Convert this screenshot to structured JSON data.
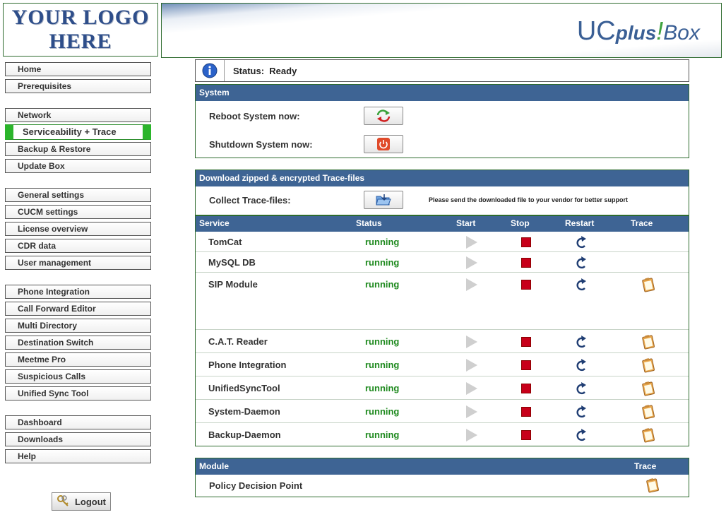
{
  "header": {
    "logo_line1": "YOUR LOGO",
    "logo_line2": "HERE",
    "brand_uc": "UC",
    "brand_plus": "plus",
    "brand_bang": "!",
    "brand_box": "Box"
  },
  "sidebar": {
    "groups": [
      [
        "Home",
        "Prerequisites"
      ],
      [
        "Network",
        "Serviceability + Trace",
        "Backup & Restore",
        "Update Box"
      ],
      [
        "General settings",
        "CUCM settings",
        "License overview",
        "CDR data",
        "User management"
      ],
      [
        "Phone Integration",
        "Call Forward Editor",
        "Multi Directory",
        "Destination Switch",
        "Meetme Pro",
        "Suspicious Calls",
        "Unified Sync Tool"
      ],
      [
        "Dashboard",
        "Downloads",
        "Help"
      ]
    ],
    "active": "Serviceability + Trace",
    "logout_label": "Logout"
  },
  "status": {
    "label": "Status:",
    "value": "Ready"
  },
  "system": {
    "title": "System",
    "reboot_label": "Reboot System now:",
    "shutdown_label": "Shutdown System now:"
  },
  "download": {
    "title": "Download zipped & encrypted Trace-files",
    "collect_label": "Collect Trace-files:",
    "note": "Please send the downloaded file to your vendor for better support"
  },
  "services": {
    "columns": {
      "service": "Service",
      "status": "Status",
      "start": "Start",
      "stop": "Stop",
      "restart": "Restart",
      "trace": "Trace"
    },
    "rows": [
      {
        "name": "TomCat",
        "status": "running",
        "trace": false
      },
      {
        "name": "MySQL DB",
        "status": "running",
        "trace": false
      },
      {
        "name": "SIP Module",
        "status": "running",
        "trace": true
      },
      {
        "name": "C.A.T. Reader",
        "status": "running",
        "trace": true
      },
      {
        "name": "Phone Integration",
        "status": "running",
        "trace": true
      },
      {
        "name": "UnifiedSyncTool",
        "status": "running",
        "trace": true
      },
      {
        "name": "System-Daemon",
        "status": "running",
        "trace": true
      },
      {
        "name": "Backup-Daemon",
        "status": "running",
        "trace": true
      }
    ]
  },
  "modules": {
    "title": "Module",
    "trace_col": "Trace",
    "rows": [
      {
        "name": "Policy Decision Point"
      }
    ]
  },
  "colors": {
    "header_blue": "#3e6494",
    "running_green": "#1f8a1f",
    "active_green": "#2bb52b",
    "stop_red": "#c8001a"
  },
  "icons": {
    "info": "info-icon",
    "reboot": "reboot-arrows-icon",
    "shutdown": "power-icon",
    "collect": "folder-download-icon",
    "start": "play-icon",
    "stop": "stop-icon",
    "restart": "restart-arrow-icon",
    "trace": "clipboard-icon",
    "logout": "keys-icon"
  }
}
